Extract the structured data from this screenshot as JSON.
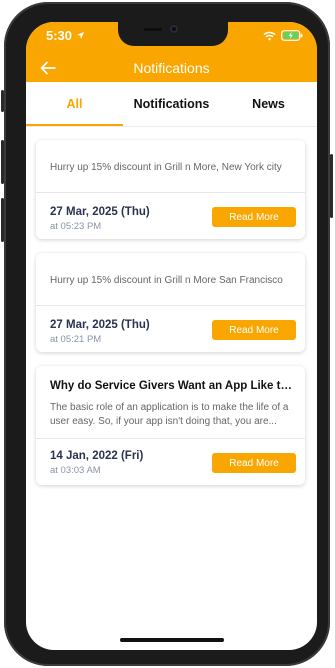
{
  "status_bar": {
    "time": "5:30"
  },
  "header": {
    "title": "Notifications"
  },
  "tabs": [
    {
      "label": "All",
      "active": true
    },
    {
      "label": "Notifications",
      "active": false
    },
    {
      "label": "News",
      "active": false
    }
  ],
  "cards": [
    {
      "message": "Hurry up 15% discount in Grill n More, New York city",
      "date": "27 Mar, 2025 (Thu)",
      "time": "at 05:23 PM",
      "button": "Read More"
    },
    {
      "message": "Hurry up 15% discount in Grill n More San Francisco",
      "date": "27 Mar, 2025 (Thu)",
      "time": "at 05:21 PM",
      "button": "Read More"
    },
    {
      "title": "Why do Service Givers Want an App Like th...",
      "body": "The basic role of an application is to make the life of a user easy. So, if your app isn't doing that, you are...",
      "date": "14 Jan, 2022 (Fri)",
      "time": "at 03:03 AM",
      "button": "Read More"
    }
  ],
  "colors": {
    "accent": "#f9a600",
    "date_text": "#2a3350",
    "time_text": "#8a93a8"
  },
  "icons": [
    "location-arrow-icon",
    "wifi-icon",
    "battery-charging-icon",
    "back-arrow-icon"
  ]
}
